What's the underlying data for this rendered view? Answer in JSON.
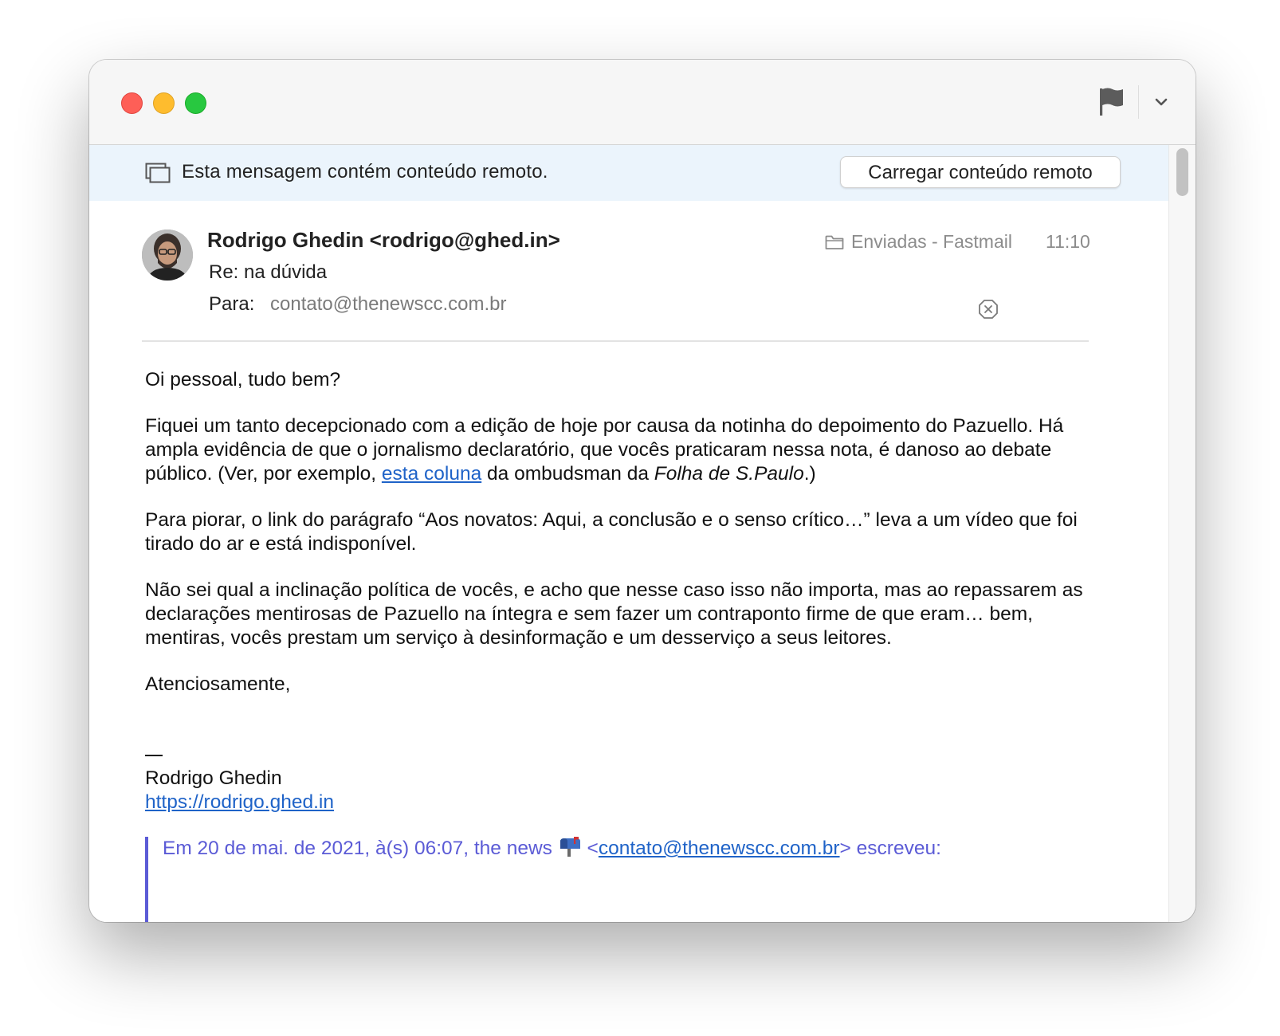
{
  "banner": {
    "text": "Esta mensagem contém conteúdo remoto.",
    "button_label": "Carregar conteúdo remoto"
  },
  "message": {
    "sender": "Rodrigo Ghedin <rodrigo@ghed.in>",
    "subject": "Re: na dúvida",
    "to_label": "Para:",
    "to_value": "contato@thenewscc.com.br",
    "mailbox": "Enviadas - Fastmail",
    "time": "11:10"
  },
  "body": {
    "greeting": "Oi pessoal, tudo bem?",
    "p1_part1": "Fiquei um tanto decepcionado com a edição de hoje por causa da notinha do depoimento do Pazuello. Há ampla evidência de que o jornalismo declaratório, que vocês praticaram nessa nota, é danoso ao debate público. (Ver, por exemplo, ",
    "p1_link": "esta coluna",
    "p1_part2": " da ombudsman da ",
    "p1_italic": "Folha de S.Paulo",
    "p1_part3": ".)",
    "p2": "Para piorar, o link do parágrafo “Aos novatos: Aqui, a conclusão e o senso crítico…” leva a um vídeo que foi tirado do ar e está indisponível.",
    "p3": "Não sei qual a inclinação política de vocês, e acho que nesse caso isso não importa, mas ao repassarem as declarações mentirosas de Pazuello na íntegra e sem fazer um contraponto firme de que eram… bem, mentiras, vocês prestam um serviço à desinformação e um desserviço a seus leitores.",
    "closing": "Atenciosamente,",
    "signature_name": "Rodrigo Ghedin",
    "signature_url": "https://rodrigo.ghed.in"
  },
  "quote": {
    "prefix": "Em 20 de mai. de 2021, à(s) 06:07, the news ",
    "lt": " <",
    "email": "contato@thenewscc.com.br",
    "suffix": "> escreveu:"
  },
  "icons": {
    "flag": "flag-icon",
    "chevron": "chevron-down-icon",
    "remote_content": "remote-content-icon",
    "folder": "folder-icon",
    "remove": "remove-recipient-icon",
    "mailbox_emoji": "mailbox-icon"
  },
  "colors": {
    "banner_bg": "#ebf4fc",
    "link": "#1f63c8",
    "quote": "#5b5bd6",
    "close": "#fe5f57",
    "minimize": "#febc2e",
    "maximize": "#28c840"
  }
}
